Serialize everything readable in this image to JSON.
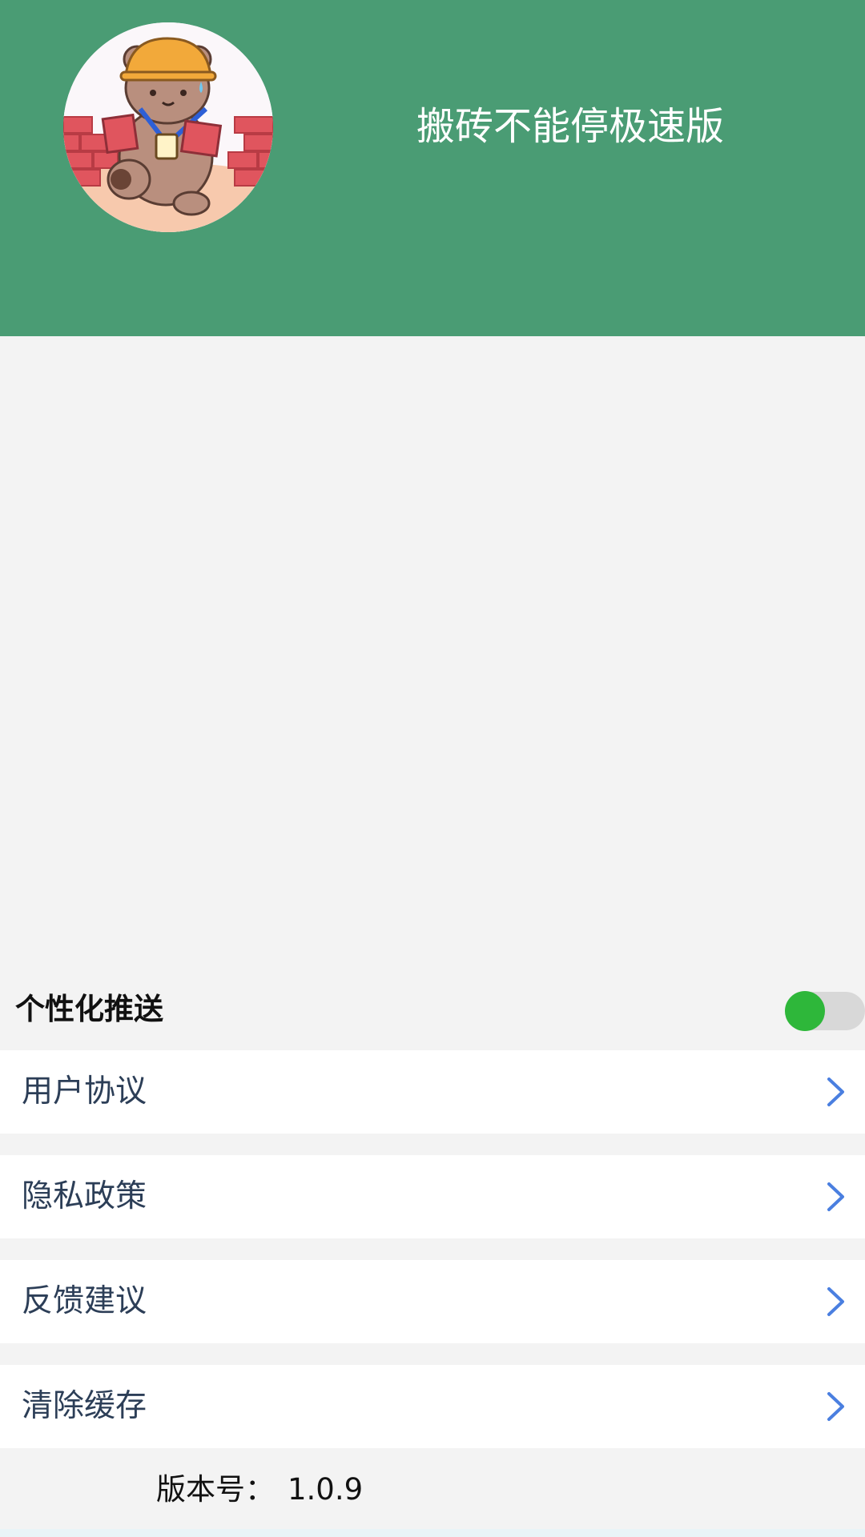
{
  "header": {
    "app_title": "搬砖不能停极速版",
    "background_color": "#4a9c74",
    "avatar_icon": "bear-carrying-bricks-avatar"
  },
  "settings": {
    "push": {
      "label": "个性化推送",
      "enabled": true,
      "knob_color": "#2eb73a"
    },
    "menu": [
      {
        "label": "用户协议",
        "icon": "chevron-right-icon"
      },
      {
        "label": "隐私政策",
        "icon": "chevron-right-icon"
      },
      {
        "label": "反馈建议",
        "icon": "chevron-right-icon"
      },
      {
        "label": "清除缓存",
        "icon": "chevron-right-icon"
      }
    ],
    "accent_color": "#4a7fe0"
  },
  "footer": {
    "version_label": "版本号：",
    "version_value": "1.0.9"
  }
}
